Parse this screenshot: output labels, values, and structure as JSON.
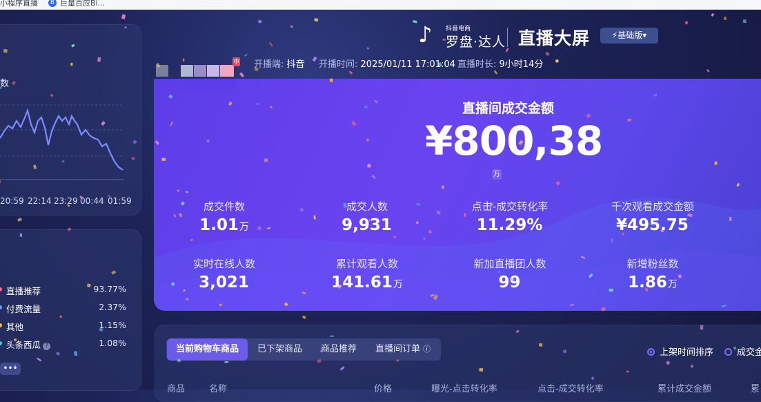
{
  "topbar": {
    "tab1": "小程序直播",
    "tab2_icon": "B",
    "tab2": "巨量百应Bi..."
  },
  "left_trend": {
    "label": "数",
    "times": [
      "20:59",
      "22:14",
      "23:29",
      "00:44",
      "01:59"
    ],
    "line_color": "#7d8bff"
  },
  "traffic_sources": [
    {
      "name": "直播推荐",
      "pct": "93.77%",
      "color": "#ff6b8a"
    },
    {
      "name": "付费流量",
      "pct": "2.37%",
      "color": "#5aa9ff"
    },
    {
      "name": "其他",
      "pct": "1.15%",
      "color": "#ffb547"
    },
    {
      "name": "头条西瓜",
      "pct": "1.08%",
      "color": "#3ad0c8",
      "help": "?"
    }
  ],
  "more_button": "•••",
  "brand": {
    "small": "抖音电商",
    "name": "罗盘·达人",
    "title": "直播大屏",
    "version": "⚡基础版▾"
  },
  "anchor": {
    "tag": "中",
    "platform_label": "开播端:",
    "platform": "抖音",
    "start_label": "开播时间:",
    "start_time": "2025/01/11 17:01:04",
    "duration_label": "直播时长:",
    "duration": "9小时14分"
  },
  "gmv": {
    "label": "直播间成交金额",
    "value": "¥800,38",
    "unit": "万"
  },
  "metrics": [
    {
      "label": "成交件数",
      "value": "1.01",
      "unit": "万"
    },
    {
      "label": "成交人数",
      "value": "9,931",
      "unit": ""
    },
    {
      "label": "点击-成交转化率",
      "value": "11.29%",
      "unit": ""
    },
    {
      "label": "千次观看成交金额",
      "value": "¥495.75",
      "unit": ""
    },
    {
      "label": "实时在线人数",
      "value": "3,021",
      "unit": ""
    },
    {
      "label": "累计观看人数",
      "value": "141.61",
      "unit": "万"
    },
    {
      "label": "新加直播团人数",
      "value": "99",
      "unit": ""
    },
    {
      "label": "新增粉丝数",
      "value": "1.86",
      "unit": "万"
    }
  ],
  "product_tabs": [
    "当前购物车商品",
    "已下架商品",
    "商品推荐",
    "直播间订单"
  ],
  "sort_options": [
    "上架时间排序",
    "成交金"
  ],
  "table_headers": [
    "商品",
    "名称",
    "价格",
    "曝光-点击转化率",
    "点击-成交转化率",
    "累计成交金额",
    "累"
  ]
}
